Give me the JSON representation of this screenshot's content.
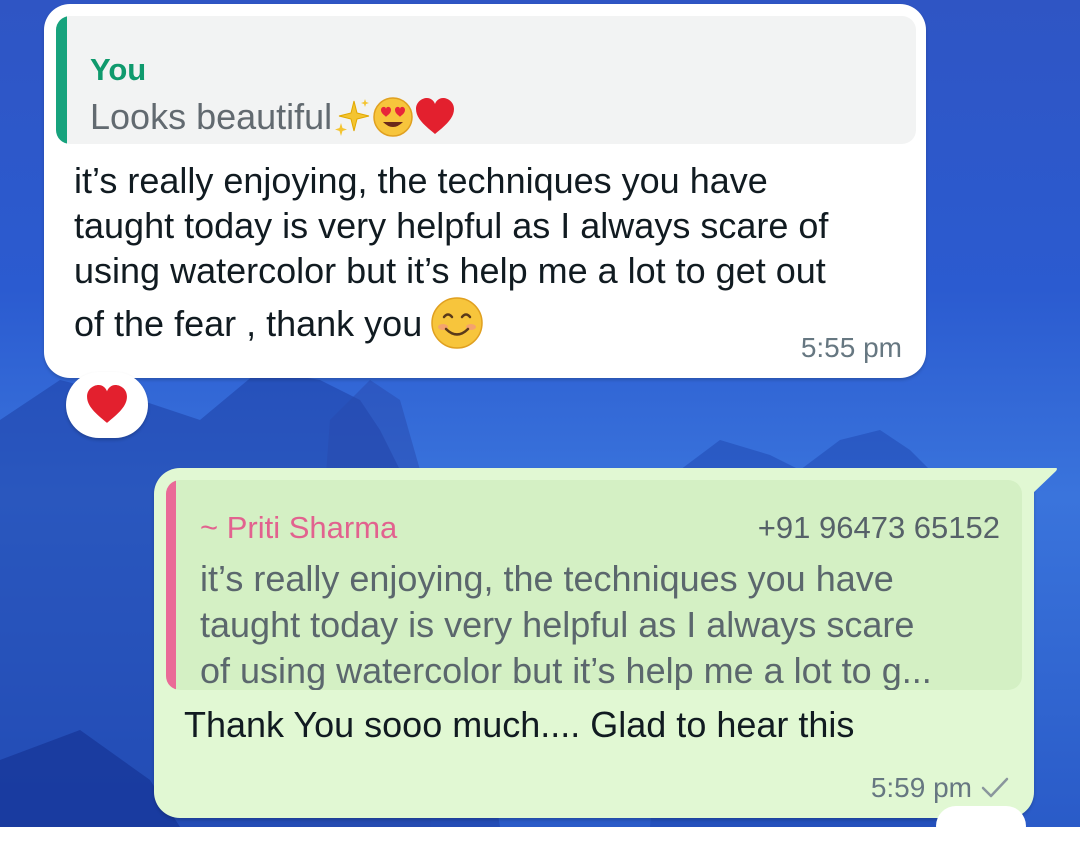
{
  "incoming_message": {
    "quoted": {
      "author": "You",
      "text": "Looks beautiful",
      "emojis": [
        "sparkles-emoji",
        "heart-eyes-emoji",
        "red-heart-emoji"
      ]
    },
    "lines": [
      "it’s really enjoying, the techniques you have",
      "taught today is very helpful as I always scare of",
      "using watercolor but it’s help me a lot to get out",
      "of the fear , thank you"
    ],
    "trailing_emoji": "smiling-face-emoji",
    "time": "5:55 pm",
    "reaction": "red-heart-emoji"
  },
  "outgoing_message": {
    "quoted": {
      "author": "~ Priti Sharma",
      "phone": "+91 96473 65152",
      "lines": [
        "it’s really enjoying, the techniques you have",
        "taught today is very helpful as I always scare",
        "of using watercolor but it’s help me a lot to g..."
      ]
    },
    "text": "Thank You sooo much.... Glad to hear this",
    "time": "5:59 pm",
    "status": "sent-check-icon"
  },
  "colors": {
    "incoming_bubble": "#ffffff",
    "outgoing_bubble": "#e1f8d3",
    "you_accent": "#17a37d",
    "member_accent": "#ea6a97",
    "timestamp": "#667781"
  }
}
